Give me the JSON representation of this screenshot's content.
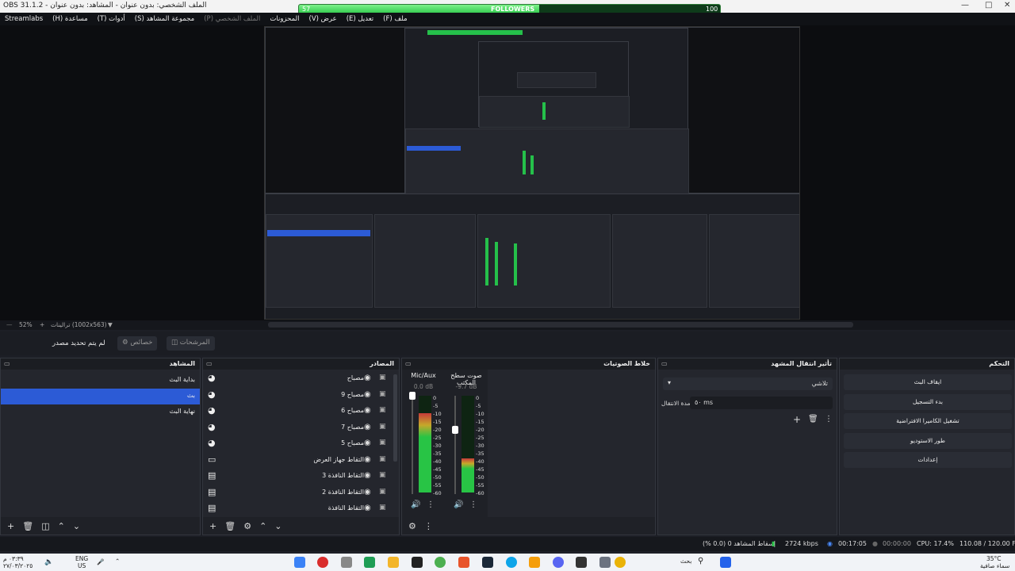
{
  "window": {
    "title": "OBS 31.1.2 - الملف الشخصي: بدون عنوان - المشاهد: بدون عنوان"
  },
  "followers": {
    "label": "FOLLOWERS",
    "current": "57",
    "goal": "100",
    "progress": 0.57
  },
  "menu": [
    {
      "label": "ملف (F)",
      "dim": false
    },
    {
      "label": "تعديل (E)",
      "dim": false
    },
    {
      "label": "عرض (V)",
      "dim": false
    },
    {
      "label": "المحزونات",
      "dim": false
    },
    {
      "label": "الملف الشخصي (P)",
      "dim": true
    },
    {
      "label": "مجموعة المشاهد (S)",
      "dim": false
    },
    {
      "label": "أدوات (T)",
      "dim": false
    },
    {
      "label": "مساعدة (H)",
      "dim": false
    },
    {
      "label": "Streamlabs",
      "dim": false
    }
  ],
  "zoom": {
    "percent": "52%",
    "resolution": "ترالينات (1002x563)"
  },
  "toolbar": {
    "no_source": "لم يتم تحديد مصدر",
    "properties": "خصائص",
    "filters": "المرشحات"
  },
  "scenes": {
    "title": "المشاهد",
    "items": [
      {
        "label": "بداية البث",
        "active": false
      },
      {
        "label": "بث",
        "active": true
      },
      {
        "label": "نهاية البث",
        "active": false
      }
    ]
  },
  "sources": {
    "title": "المصادر",
    "items": [
      {
        "label": "مصباح",
        "icon": "camera-icon"
      },
      {
        "label": "مصباح 9",
        "icon": "camera-icon"
      },
      {
        "label": "مصباح 6",
        "icon": "camera-icon"
      },
      {
        "label": "مصباح 7",
        "icon": "camera-icon"
      },
      {
        "label": "مصباح 5",
        "icon": "camera-icon"
      },
      {
        "label": "التقاط جهاز العرض",
        "icon": "monitor-icon"
      },
      {
        "label": "التقاط النافذة 3",
        "icon": "window-icon"
      },
      {
        "label": "التقاط النافذة 2",
        "icon": "window-icon"
      },
      {
        "label": "التقاط النافذة",
        "icon": "window-icon"
      }
    ]
  },
  "mixer": {
    "title": "خلاط الصوتيات",
    "scale": [
      "0",
      "-5",
      "-10",
      "-15",
      "-20",
      "-25",
      "-30",
      "-35",
      "-40",
      "-45",
      "-50",
      "-55",
      "-60"
    ],
    "channels": [
      {
        "name": "Mic/Aux",
        "db": "0.0 dB",
        "level": 0.82,
        "fader": 0.0
      },
      {
        "name": "صوت سطح المكتب",
        "db": "-9.7 dB",
        "level": 0.35,
        "fader": 0.35
      }
    ]
  },
  "transitions": {
    "title": "تأثير انتقال المشهد",
    "selected": "تلاشي",
    "duration_label": "مدة الانتقال",
    "duration_value": "٥٠ ms"
  },
  "controls": {
    "title": "التحكم",
    "buttons": [
      "ايقاف البث",
      "بدء التسجيل",
      "تشغيل الكاميرا الافتراضية",
      "طور الاستوديو",
      "إعدادات"
    ]
  },
  "status": {
    "dropped": "إسقاط المشاهد 0 (0.0 %)",
    "bitrate": "2724 kbps",
    "stream_time": "00:17:05",
    "rec_time": "00:00:00",
    "cpu": "CPU: 17.4%",
    "fps": "110.08 / 120.00 FPS"
  },
  "taskbar": {
    "time": "٠٣:٣٩ م",
    "date": "٢٧/٠٣/٢٠٢٥",
    "lang": "ENG",
    "region": "US",
    "search": "بحث",
    "weather_temp": "35°C",
    "weather_desc": "سماء صافية"
  },
  "colors": {
    "accent": "#2c5bd6",
    "meter_green": "#28c445",
    "follower_green": "#24c443"
  }
}
